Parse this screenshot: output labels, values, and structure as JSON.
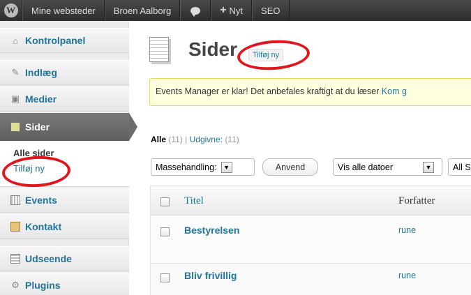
{
  "adminbar": {
    "wp_logo": "W",
    "sites": "Mine websteder",
    "site_name": "Broen Aalborg",
    "new": "Nyt",
    "seo": "SEO"
  },
  "sidebar": {
    "items": [
      {
        "label": "Kontrolpanel",
        "icon": "house-icon"
      },
      {
        "label": "Indlæg",
        "icon": "pushpin-icon"
      },
      {
        "label": "Medier",
        "icon": "camera-icon"
      },
      {
        "label": "Sider",
        "icon": "pages-icon"
      },
      {
        "label": "Events",
        "icon": "calendar-icon"
      },
      {
        "label": "Kontakt",
        "icon": "contact-form-icon"
      },
      {
        "label": "Udseende",
        "icon": "appearance-icon"
      },
      {
        "label": "Plugins",
        "icon": "plug-icon"
      }
    ],
    "submenu": {
      "all": "Alle sider",
      "add_new": "Tilføj ny"
    }
  },
  "header": {
    "title": "Sider",
    "add_new": "Tilføj ny"
  },
  "notice": {
    "text": "Events Manager er klar! Det anbefales kraftigt at du læser ",
    "link": "Kom g"
  },
  "filters": {
    "all_label": "Alle",
    "all_count": "(11)",
    "sep": "|",
    "published_label": "Udgivne:",
    "published_count": "(11)"
  },
  "bulk": {
    "select": "Massehandling:",
    "apply": "Anvend",
    "dates": "Vis alle datoer",
    "cats": "All S"
  },
  "table": {
    "columns": {
      "title": "Titel",
      "author": "Forfatter"
    },
    "rows": [
      {
        "title": "Bestyrelsen",
        "author": "rune"
      },
      {
        "title": "Bliv frivillig",
        "author": "rune"
      }
    ]
  },
  "colors": {
    "link": "#21759b",
    "annotation": "#e0161c",
    "current_menu": "#6b6b6b",
    "notice_bg": "#ffffe0"
  }
}
